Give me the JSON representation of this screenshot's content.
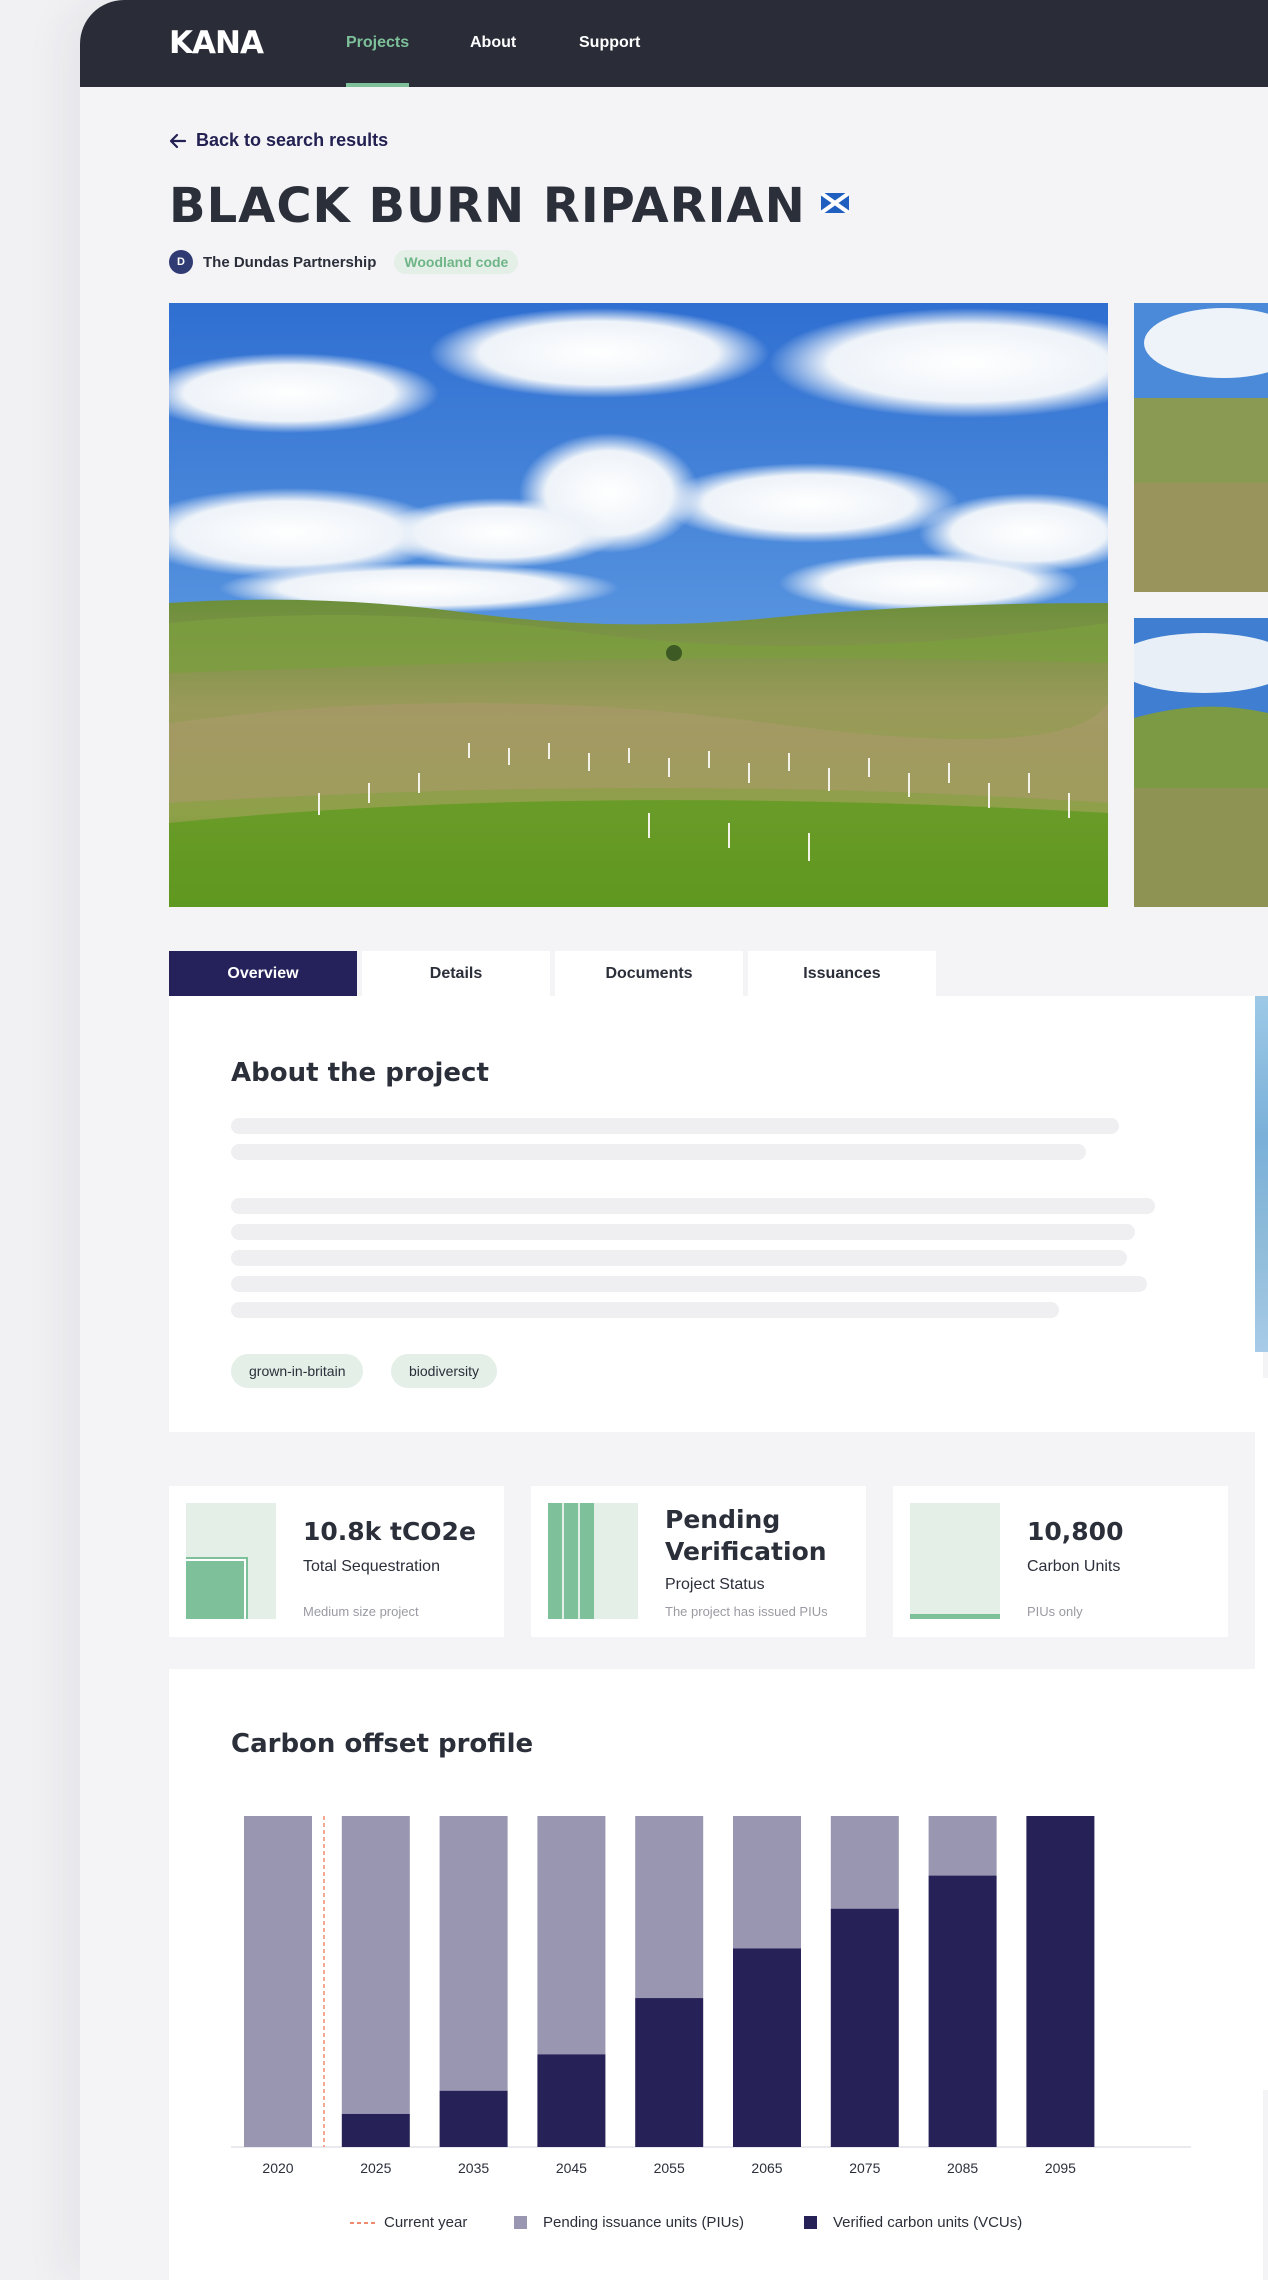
{
  "nav": {
    "logo": "KANA",
    "items": [
      {
        "label": "Projects",
        "active": true
      },
      {
        "label": "About",
        "active": false
      },
      {
        "label": "Support",
        "active": false
      }
    ]
  },
  "project": {
    "back_label": "Back to search results",
    "title": "BLACK BURN RIPARIAN",
    "country_flag_icon": "scotland-flag-icon",
    "developer": "The Dundas Partnership",
    "developer_initials": "D",
    "code_badge": "Woodland code"
  },
  "tabs": [
    {
      "label": "Overview",
      "active": true
    },
    {
      "label": "Details",
      "active": false
    },
    {
      "label": "Documents",
      "active": false
    },
    {
      "label": "Issuances",
      "active": false
    }
  ],
  "about": {
    "heading": "About the project",
    "tags": [
      "grown-in-britain",
      "biodiversity"
    ]
  },
  "stats": [
    {
      "value": "10.8k tCO2e",
      "label": "Total Sequestration",
      "note": "Medium size project"
    },
    {
      "value": "Pending Verification",
      "label": "Project Status",
      "note": "The project has issued PIUs"
    },
    {
      "value": "10,800",
      "label": "Carbon Units",
      "note": "PIUs only"
    }
  ],
  "colors": {
    "nav_bg": "#2a2d37",
    "accent_green": "#7dc09a",
    "brand_navy": "#25215b",
    "pending_color": "#9896b1",
    "verified_color": "#262258",
    "current_year_color": "#f08c6e"
  },
  "chart_data": {
    "type": "bar",
    "stacked": true,
    "title": "Carbon offset profile",
    "categories": [
      "2020",
      "2025",
      "2035",
      "2045",
      "2055",
      "2065",
      "2075",
      "2085",
      "2095"
    ],
    "series": [
      {
        "name": "Verified carbon units (VCUs)",
        "values": [
          0,
          10,
          17,
          28,
          45,
          60,
          72,
          82,
          100
        ]
      },
      {
        "name": "Pending issuance units (PIUs)",
        "values": [
          100,
          90,
          83,
          72,
          55,
          40,
          28,
          18,
          0
        ]
      }
    ],
    "current_year_marker": "Current year",
    "legend": [
      "Current year",
      "Pending issuance units (PIUs)",
      "Verified carbon units (VCUs)"
    ],
    "legend_position": "bottom",
    "ylim": [
      0,
      100
    ],
    "grid": false
  }
}
